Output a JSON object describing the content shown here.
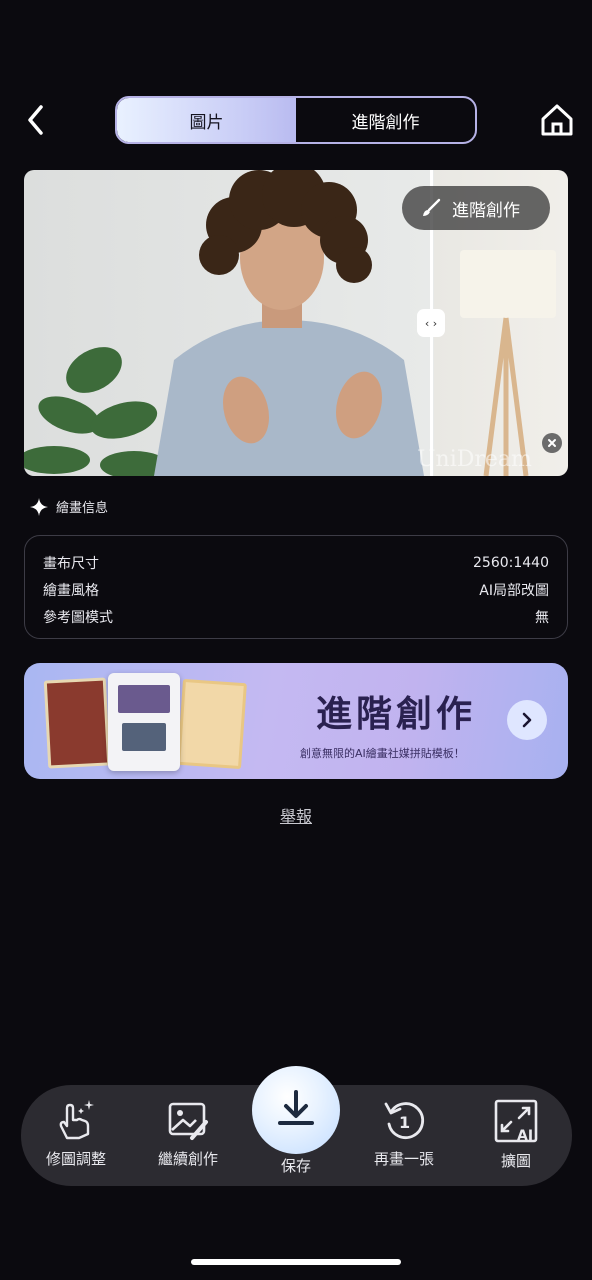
{
  "header": {
    "tabs": [
      {
        "label": "圖片",
        "active": true
      },
      {
        "label": "進階創作",
        "active": false
      }
    ]
  },
  "hero": {
    "badge_label": "進階創作",
    "handle_glyph": "‹ ›",
    "watermark": "UniDream"
  },
  "info": {
    "title": "繪畫信息",
    "rows": [
      {
        "label": "畫布尺寸",
        "value": "2560:1440"
      },
      {
        "label": "繪畫風格",
        "value": "AI局部改圖"
      },
      {
        "label": "參考圖模式",
        "value": "無"
      }
    ]
  },
  "banner": {
    "title": "進階創作",
    "subtitle": "創意無限的AI繪畫社媒拼貼模板！"
  },
  "report_label": "舉報",
  "toolbar": {
    "items": [
      {
        "label": "修圖調整",
        "icon": "hand-sparkle-icon"
      },
      {
        "label": "繼續創作",
        "icon": "image-edit-icon"
      },
      {
        "label": "保存",
        "icon": "download-icon"
      },
      {
        "label": "再畫一張",
        "icon": "redo-one-icon"
      },
      {
        "label": "擴圖",
        "icon": "expand-ai-icon"
      }
    ]
  },
  "colors": {
    "background": "#0b0a0f",
    "tab_active_start": "#e9f1ff",
    "tab_active_end": "#b9bbf0",
    "toolbar_bg": "#2c2b31",
    "banner_start": "#a9b7f2",
    "banner_end": "#c1b3ef"
  }
}
